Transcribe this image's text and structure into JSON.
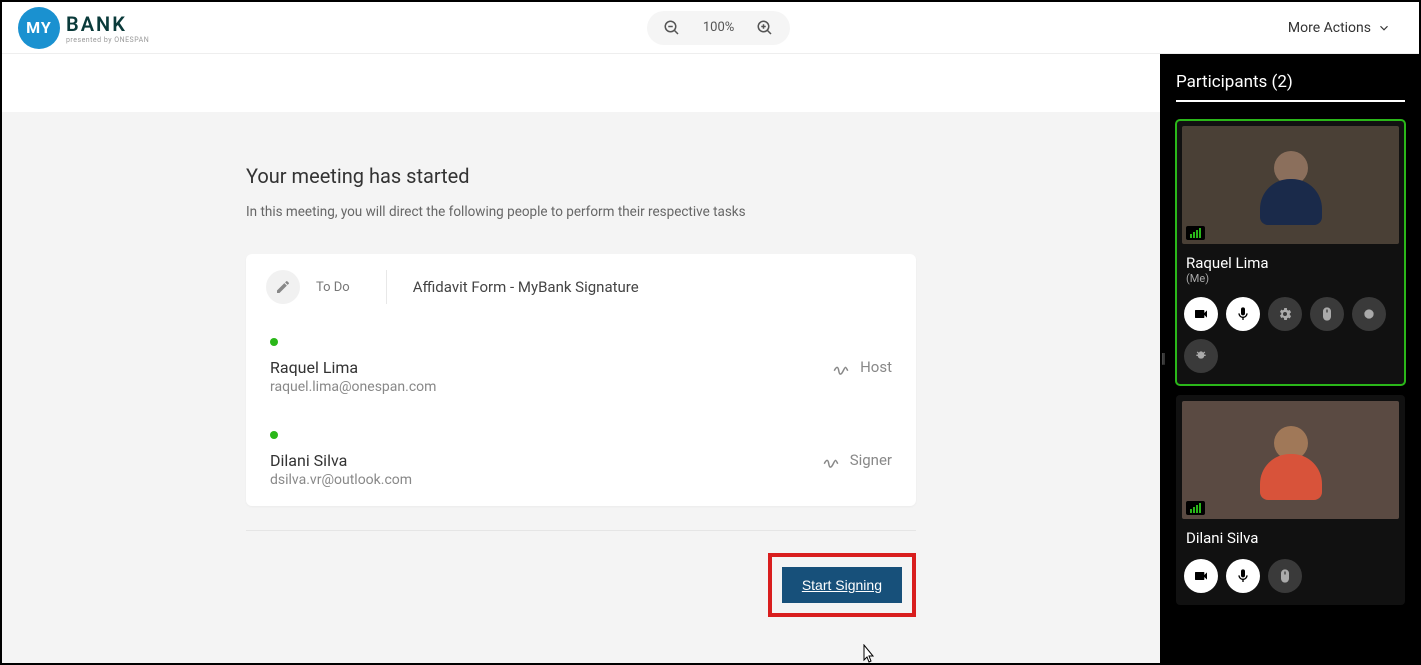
{
  "header": {
    "logo_circle_text": "MY",
    "logo_bank_text": "BANK",
    "logo_sub_text": "presented by ONESPAN",
    "zoom_value": "100%",
    "more_actions_label": "More Actions"
  },
  "main": {
    "title": "Your meeting has started",
    "subtitle": "In this meeting, you will direct the following people to perform their respective tasks",
    "todo_label": "To Do",
    "document_name": "Affidavit Form - MyBank Signature",
    "people": [
      {
        "name": "Raquel Lima",
        "email": "raquel.lima@onespan.com",
        "role": "Host",
        "dot_color": "#2ab719"
      },
      {
        "name": "Dilani Silva",
        "email": "dsilva.vr@outlook.com",
        "role": "Signer",
        "dot_color": "#2ab719"
      }
    ],
    "start_signing_label": "Start Signing"
  },
  "sidebar": {
    "title": "Participants (2)",
    "participants": [
      {
        "name": "Raquel Lima",
        "me_tag": "(Me)",
        "active": true
      },
      {
        "name": "Dilani Silva",
        "me_tag": "",
        "active": false
      }
    ]
  },
  "colors": {
    "accent": "#17507a",
    "highlight": "#d91e1e",
    "online_dot": "#2ab719"
  }
}
